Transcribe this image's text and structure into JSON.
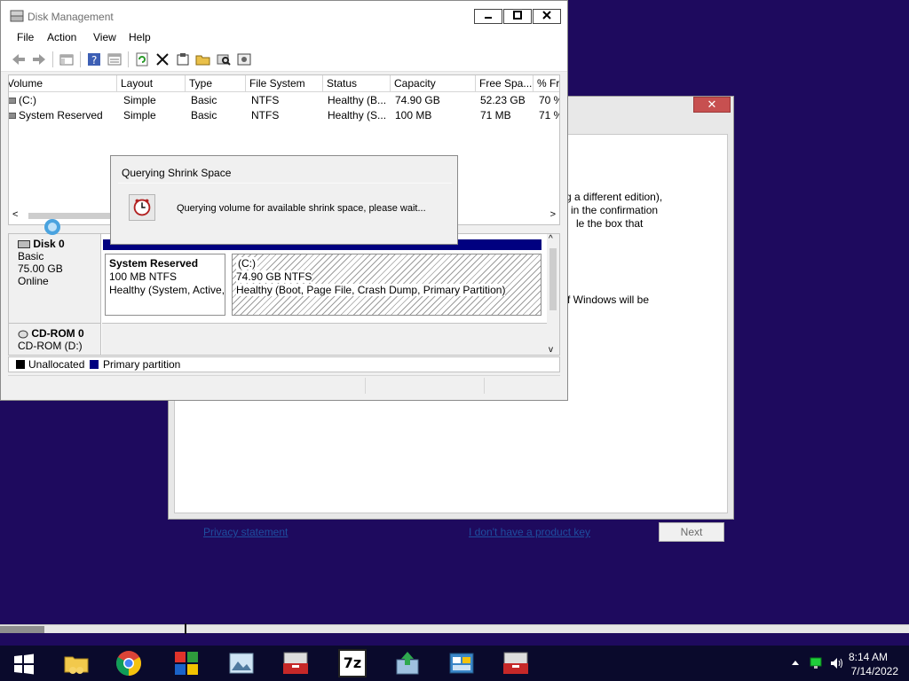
{
  "setup_window": {
    "close_glyph": "✕",
    "text_lines": [
      "g a different edition),",
      "in the confirmation",
      "le the box that",
      "f Windows will be"
    ],
    "privacy_link": "Privacy statement",
    "no_key_link": "I don't have a product key",
    "next_button": "Next"
  },
  "disk_management": {
    "title": "Disk Management",
    "menu": [
      "File",
      "Action",
      "View",
      "Help"
    ],
    "columns": [
      "Volume",
      "Layout",
      "Type",
      "File System",
      "Status",
      "Capacity",
      "Free Spa...",
      "% Fr"
    ],
    "rows": [
      [
        "(C:)",
        "Simple",
        "Basic",
        "NTFS",
        "Healthy (B...",
        "74.90 GB",
        "52.23 GB",
        "70 %"
      ],
      [
        "System Reserved",
        "Simple",
        "Basic",
        "NTFS",
        "Healthy (S...",
        "100 MB",
        "71 MB",
        "71 %"
      ]
    ],
    "disks": [
      {
        "name": "Disk 0",
        "type": "Basic",
        "size": "75.00 GB",
        "state": "Online"
      },
      {
        "name": "CD-ROM 0",
        "type": "CD-ROM (D:)"
      }
    ],
    "partitions": [
      {
        "name": "System Reserved",
        "size": "100 MB NTFS",
        "status": "Healthy (System, Active,"
      },
      {
        "name": "(C:)",
        "size": "74.90 GB NTFS",
        "status": "Healthy (Boot, Page File, Crash Dump, Primary Partition)"
      }
    ],
    "legend": [
      {
        "label": "Unallocated",
        "color": "#000000"
      },
      {
        "label": "Primary partition",
        "color": "#000080"
      }
    ],
    "scroll": {
      "left": "<",
      "right": ">",
      "up": "^",
      "down": "v"
    }
  },
  "query_dialog": {
    "title": "Querying Shrink Space",
    "message": "Querying volume for available shrink space, please wait..."
  },
  "taskbar": {
    "apps": [
      "file-explorer",
      "google-chrome",
      "windows-media",
      "image-viewer",
      "toolbox",
      "7-zip",
      "installer",
      "control-panel",
      "toolbox-2"
    ],
    "app_7zip_label": "7z",
    "time": "8:14 AM",
    "date": "7/14/2022"
  },
  "colors": {
    "desktop": "#1e0a5e",
    "accent_blue": "#000080",
    "link": "#1e4e9f"
  }
}
